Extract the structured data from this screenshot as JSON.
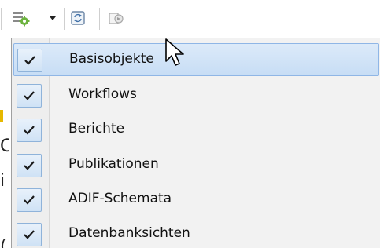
{
  "toolbar": {
    "icons": [
      "module-view-icon",
      "chevron-down-icon",
      "refresh-icon",
      "export-icon"
    ]
  },
  "menu": {
    "items": [
      {
        "label": "Basisobjekte",
        "checked": true,
        "highlighted": true
      },
      {
        "label": "Workflows",
        "checked": true,
        "highlighted": false
      },
      {
        "label": "Berichte",
        "checked": true,
        "highlighted": false
      },
      {
        "label": "Publikationen",
        "checked": true,
        "highlighted": false
      },
      {
        "label": "ADIF-Schemata",
        "checked": true,
        "highlighted": false
      },
      {
        "label": "Datenbanksichten",
        "checked": true,
        "highlighted": false
      }
    ]
  },
  "colors": {
    "highlight": "#c7ddf5",
    "highlight_border": "#8fb6e6",
    "menu_background": "#f2f2f2",
    "check": "#1a1a1a"
  }
}
